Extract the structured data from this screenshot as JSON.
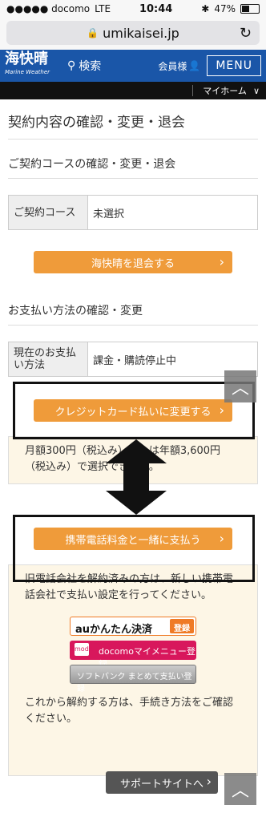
{
  "statusbar": {
    "carrier": "●●●●● docomo",
    "network": "LTE",
    "time": "10:44",
    "battery": "47%"
  },
  "browser": {
    "url": "umikaisei.jp",
    "reload_icon": "reload-icon"
  },
  "header": {
    "logo": "海快晴",
    "logo_sub": "Marine Weather",
    "search_label": "検索",
    "member_label": "会員様",
    "menu_label": "MENU"
  },
  "subnav": {
    "item": "マイホーム",
    "chevron": "∨"
  },
  "page": {
    "title": "契約内容の確認・変更・退会",
    "course_section": "ご契約コースの確認・変更・退会",
    "course_row": {
      "label": "ご契約コース",
      "value": "未選択"
    },
    "withdraw_button": "海快晴を退会する",
    "payment_section": "お支払い方法の確認・変更",
    "payment_row": {
      "label": "現在のお支払い方法",
      "value": "課金・購読停止中"
    },
    "credit_button": "クレジットカード払いに変更する",
    "credit_text": "月額300円（税込み）または年額3,600円（税込み）で選択できます。",
    "mobile_button": "携帯電話料金と一緒に支払う",
    "mobile_text": "旧電話会社を解約済みの方は、新しい携帯電話会社で支払い設定を行ってください。",
    "au_label": "auかんたん決済",
    "au_tag": "登録",
    "docomo_label": "docomoマイメニュー登録",
    "docomo_icon": "mode",
    "softbank_label": "ソフトバンク まとめて支払い登録",
    "cancel_text": "これから解約する方は、手続き方法をご確認ください。",
    "support_button": "サポートサイトへ"
  },
  "colors": {
    "header": "#1a56a8",
    "orange": "#ef9b3a",
    "docomo": "#d8175c",
    "au": "#ef7a26"
  }
}
